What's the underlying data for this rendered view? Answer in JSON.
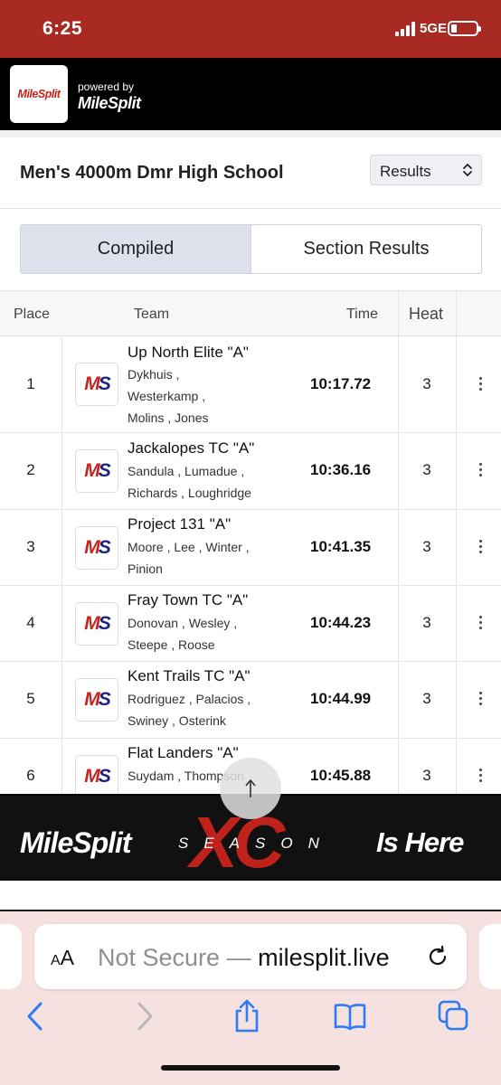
{
  "status_bar": {
    "time": "6:25",
    "network": "5GE"
  },
  "header": {
    "logo_text": "MileSplit",
    "powered_by": "powered by",
    "powered_brand": "MileSplit"
  },
  "event": {
    "title": "Men's 4000m Dmr High School",
    "view_select": "Results"
  },
  "tabs": [
    {
      "label": "Compiled",
      "active": true
    },
    {
      "label": "Section Results",
      "active": false
    }
  ],
  "table": {
    "headers": {
      "place": "Place",
      "team": "Team",
      "time": "Time",
      "heat": "Heat"
    },
    "rows": [
      {
        "place": "1",
        "team": "Up North Elite \"A\"",
        "members": [
          "Dykhuis ,",
          "Westerkamp ,",
          "Molins , Jones"
        ],
        "time": "10:17.72",
        "heat": "3"
      },
      {
        "place": "2",
        "team": "Jackalopes TC \"A\"",
        "members": [
          "Sandula , Lumadue ,",
          "Richards , Loughridge"
        ],
        "time": "10:36.16",
        "heat": "3"
      },
      {
        "place": "3",
        "team": "Project 131 \"A\"",
        "members": [
          "Moore , Lee , Winter ,",
          "Pinion"
        ],
        "time": "10:41.35",
        "heat": "3"
      },
      {
        "place": "4",
        "team": "Fray Town TC \"A\"",
        "members": [
          "Donovan , Wesley ,",
          "Steepe , Roose"
        ],
        "time": "10:44.23",
        "heat": "3"
      },
      {
        "place": "5",
        "team": "Kent Trails TC \"A\"",
        "members": [
          "Rodriguez , Palacios ,",
          "Swiney , Osterink"
        ],
        "time": "10:44.99",
        "heat": "3"
      },
      {
        "place": "6",
        "team": "Flat Landers \"A\"",
        "members": [
          "Suydam , Thompson"
        ],
        "time": "10:45.88",
        "heat": "3"
      }
    ]
  },
  "ad": {
    "brand": "MileSplit",
    "season": "SEASON",
    "xc": "XC",
    "tagline": "Is Here"
  },
  "browser": {
    "aa": "AA",
    "not_secure": "Not Secure —",
    "domain": "milesplit.live"
  },
  "colors": {
    "brand_red": "#a92a22",
    "logo_red": "#c8231b",
    "logo_navy": "#1a237e",
    "safari_blue": "#2f7bf6"
  }
}
